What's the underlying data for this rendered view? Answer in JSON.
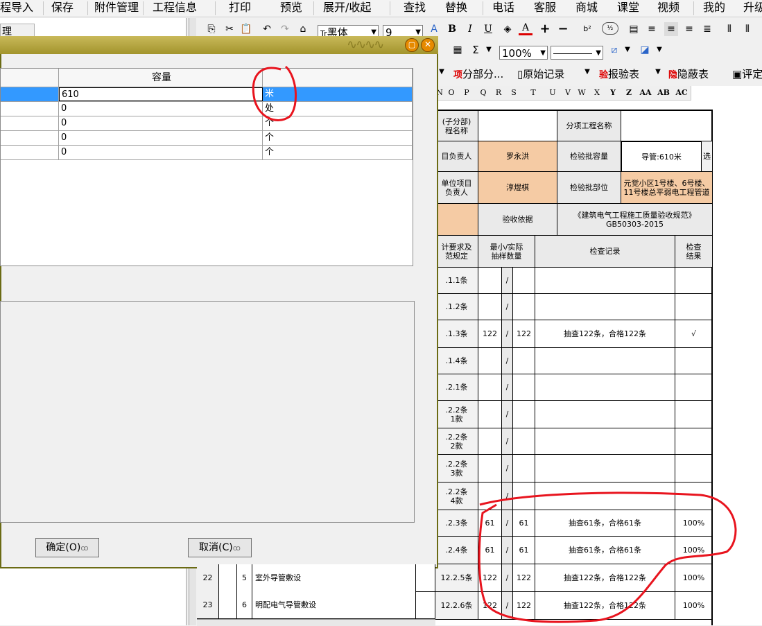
{
  "menu": [
    "程导入",
    "保存",
    "附件管理",
    "工程信息",
    "打印",
    "预览",
    "展开/收起",
    "查找",
    "替换",
    "电话",
    "客服",
    "商城",
    "课堂",
    "视频",
    "我的",
    "升级"
  ],
  "left_panel_tab": "理",
  "toolbar1": {
    "font_name": "黑体",
    "font_size": "9",
    "bold": "B",
    "italic": "I",
    "underline": "U",
    "font_color": "A",
    "plus": "+",
    "minus": "−",
    "superscript": "b²"
  },
  "toolbar2": {
    "sum": "Σ",
    "zoom": "100%"
  },
  "toolbar3": {
    "subitem_prefix": "项",
    "subitem": "分部分...",
    "original_record": "原始记录",
    "report_prefix": "验",
    "report": "报验表",
    "hidden_prefix": "隐",
    "hidden": "隐蔽表",
    "evaluate": "评定"
  },
  "column_headers": [
    "N",
    "O",
    "P",
    "Q",
    "R",
    "S",
    "T",
    "U",
    "V",
    "W",
    "X",
    "Y",
    "Z",
    "AA",
    "AB",
    "AC"
  ],
  "sheet": {
    "subdivision_name_label": "(子分部)\n程名称",
    "subitem_name_label": "分项工程名称",
    "person_in_charge_label": "目负责人",
    "person_in_charge": "罗永洪",
    "batch_capacity_label": "检验批容量",
    "batch_capacity": "导管:610米",
    "select_button": "选",
    "unit_pm_label": "单位项目\n负责人",
    "unit_pm": "淳煜棋",
    "batch_location_label": "检验批部位",
    "batch_location": "元觉小区1号楼、6号楼、11号楼总平弱电工程管道",
    "acceptance_basis_label": "验收依据",
    "acceptance_basis": "《建筑电气工程施工质量验收规范》\nGB50303-2015",
    "design_req_label": "计要求及\n范规定",
    "sample_label": "最小/实际\n抽样数量",
    "check_record_label": "检查记录",
    "check_result_label": "检查\n结果",
    "rows": [
      {
        "rownum": "",
        "idx": "",
        "name": "",
        "clause": ".1.1条",
        "min": "",
        "slash": "/",
        "actual": "",
        "record": "",
        "result": ""
      },
      {
        "rownum": "",
        "idx": "",
        "name": "",
        "clause": ".1.2条",
        "min": "",
        "slash": "/",
        "actual": "",
        "record": "",
        "result": ""
      },
      {
        "rownum": "",
        "idx": "",
        "name": "",
        "clause": ".1.3条",
        "min": "122",
        "slash": "/",
        "actual": "122",
        "record": "抽查122条，合格122条",
        "result": "√"
      },
      {
        "rownum": "",
        "idx": "",
        "name": "",
        "clause": ".1.4条",
        "min": "",
        "slash": "/",
        "actual": "",
        "record": "",
        "result": ""
      },
      {
        "rownum": "",
        "idx": "",
        "name": "",
        "clause": ".2.1条",
        "min": "",
        "slash": "/",
        "actual": "",
        "record": "",
        "result": ""
      },
      {
        "rownum": "",
        "idx": "",
        "name": "",
        "clause": ".2.2条\n1款",
        "min": "",
        "slash": "/",
        "actual": "",
        "record": "",
        "result": ""
      },
      {
        "rownum": "",
        "idx": "",
        "name": "",
        "clause": ".2.2条\n2款",
        "min": "",
        "slash": "/",
        "actual": "",
        "record": "",
        "result": ""
      },
      {
        "rownum": "",
        "idx": "",
        "name": "",
        "clause": ".2.2条\n3款",
        "min": "",
        "slash": "/",
        "actual": "",
        "record": "",
        "result": ""
      },
      {
        "rownum": "",
        "idx": "",
        "name": "",
        "clause": ".2.2条\n4款",
        "min": "",
        "slash": "/",
        "actual": "",
        "record": "",
        "result": ""
      },
      {
        "rownum": "",
        "idx": "",
        "name": "",
        "clause": ".2.3条",
        "min": "61",
        "slash": "/",
        "actual": "61",
        "record": "抽查61条，合格61条",
        "result": "100%"
      },
      {
        "rownum": "",
        "idx": "",
        "name": "",
        "clause": ".2.4条",
        "min": "61",
        "slash": "/",
        "actual": "61",
        "record": "抽查61条，合格61条",
        "result": "100%"
      },
      {
        "rownum": "22",
        "idx": "5",
        "name": "室外导管敷设",
        "clause": "12.2.5条",
        "min": "122",
        "slash": "/",
        "actual": "122",
        "record": "抽查122条，合格122条",
        "result": "100%"
      },
      {
        "rownum": "23",
        "idx": "6",
        "name": "明配电气导管敷设",
        "clause": "12.2.6条",
        "min": "122",
        "slash": "/",
        "actual": "122",
        "record": "抽查122条，合格122条",
        "result": "100%"
      }
    ]
  },
  "dialog": {
    "header_capacity": "容量",
    "rows": [
      {
        "name": "",
        "capacity": "610",
        "unit": "米",
        "selected": true
      },
      {
        "name": "",
        "capacity": "0",
        "unit": "处",
        "selected": false
      },
      {
        "name": "",
        "capacity": "0",
        "unit": "个",
        "selected": false
      },
      {
        "name": "",
        "capacity": "0",
        "unit": "个",
        "selected": false
      },
      {
        "name": "",
        "capacity": "0",
        "unit": "个",
        "selected": false
      }
    ],
    "ok_button": "确定(O)",
    "cancel_button": "取消(C)"
  },
  "colors": {
    "annotation": "#e8141e",
    "selection": "#3399ff",
    "tan_cell": "#f5cba4",
    "dialog_title": "#a2942c"
  }
}
